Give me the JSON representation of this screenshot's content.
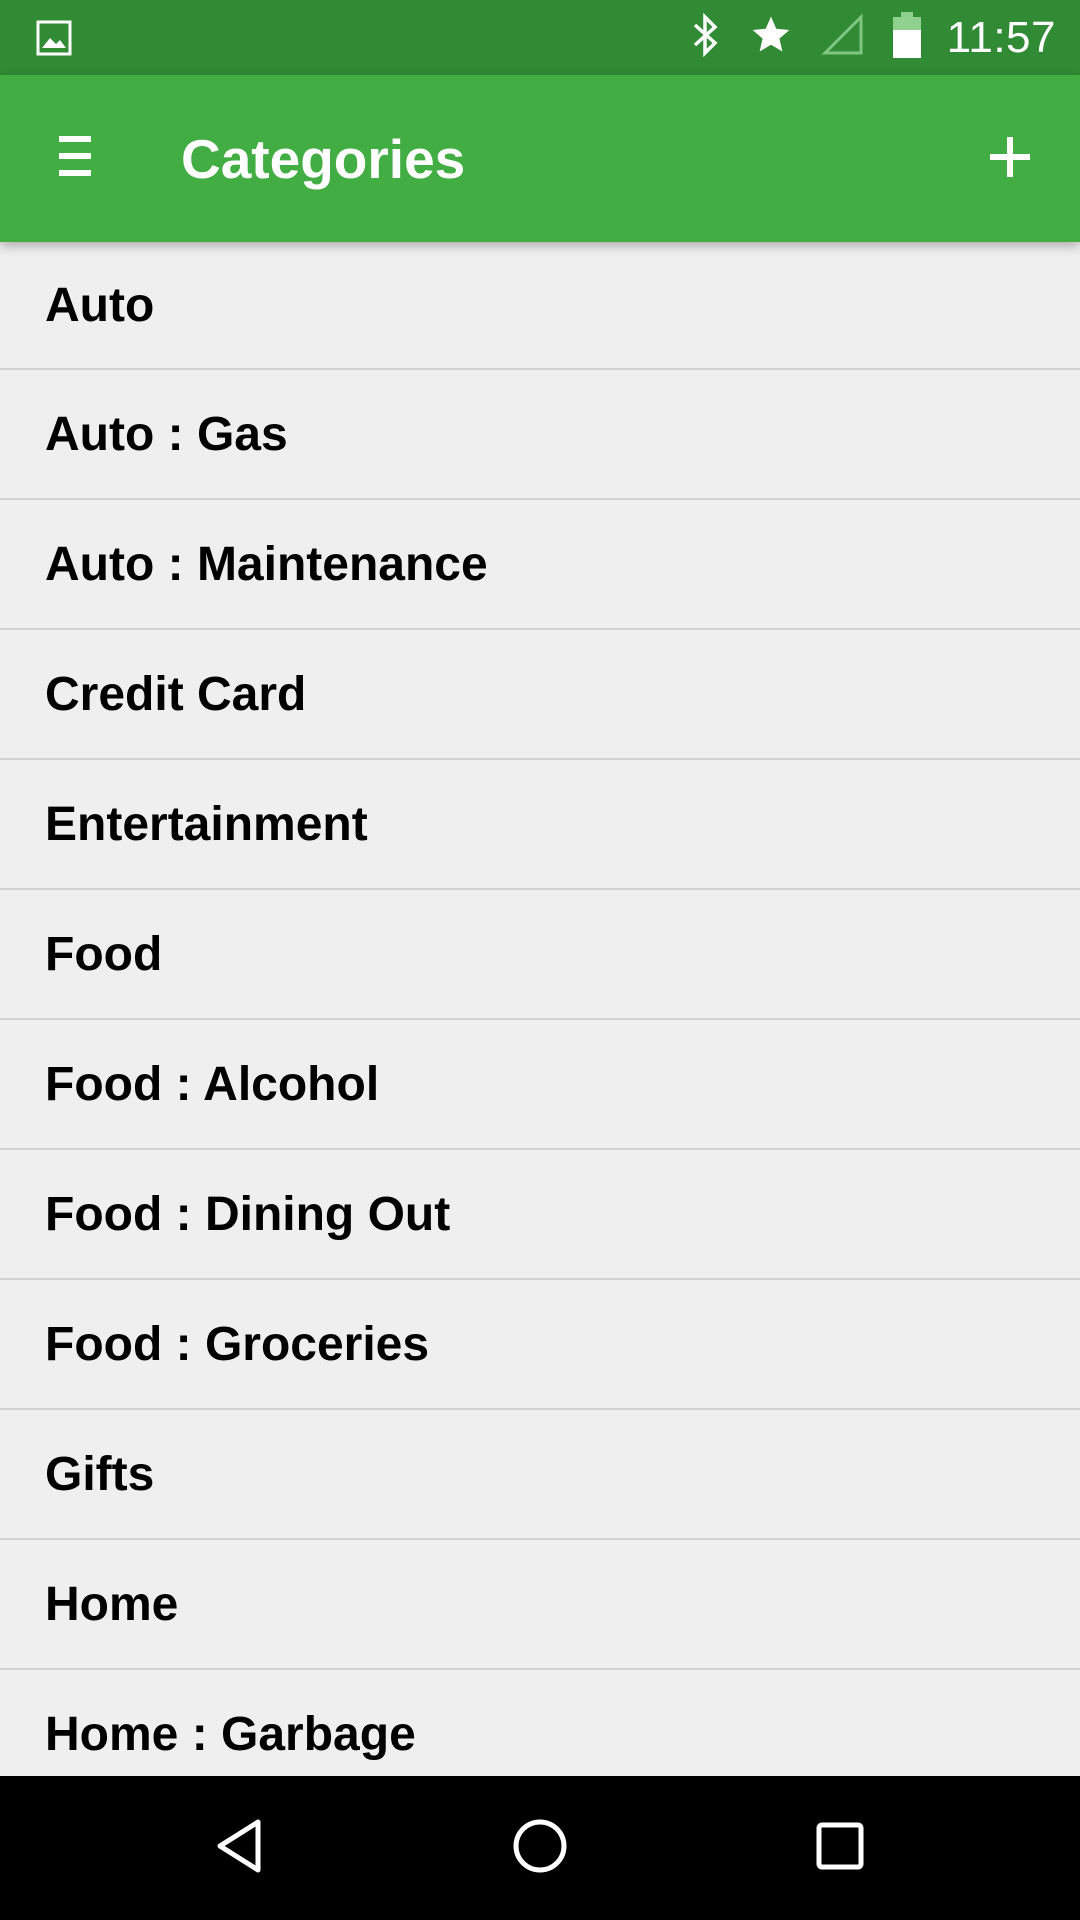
{
  "status_bar": {
    "time": "11:57",
    "icons": [
      "image-notification-icon",
      "bluetooth-icon",
      "star-icon",
      "signal-icon",
      "battery-icon"
    ]
  },
  "app_bar": {
    "title": "Categories",
    "menu_icon": "hamburger-menu-icon",
    "add_icon": "plus-icon",
    "background_color": "#41ad42"
  },
  "categories": [
    "Auto",
    "Auto : Gas",
    "Auto : Maintenance",
    "Credit Card",
    "Entertainment",
    "Food",
    "Food : Alcohol",
    "Food : Dining Out",
    "Food : Groceries",
    "Gifts",
    "Home",
    "Home : Garbage"
  ],
  "nav_bar": {
    "icons": [
      "back-icon",
      "home-icon",
      "recents-icon"
    ]
  }
}
